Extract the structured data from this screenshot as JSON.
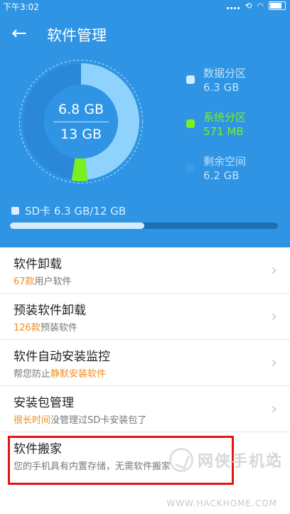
{
  "status_bar": {
    "time": "下午3:02"
  },
  "header": {
    "title": "软件管理"
  },
  "storage": {
    "used_label": "6.8 GB",
    "total_label": "13 GB",
    "segments": [
      {
        "name": "数据分区",
        "value_label": "6.3 GB",
        "value_gb": 6.3,
        "color": "#8fd2fb"
      },
      {
        "name": "系统分区",
        "value_label": "571 MB",
        "value_gb": 0.571,
        "color": "#7af020"
      },
      {
        "name": "剩余空间",
        "value_label": "6.2 GB",
        "value_gb": 6.2,
        "color": "#2b88d8"
      }
    ],
    "legend_text_colors": [
      "#bfe2ff",
      "#7af020",
      "#bfe2ff"
    ],
    "legend_dot_colors": [
      "#d4ecfd",
      "#7af020",
      "#3b9be8"
    ],
    "sd_label": "SD卡 6.3 GB/12 GB",
    "sd_fraction": 0.5
  },
  "items": [
    {
      "title": "软件卸载",
      "sub_pre": "",
      "sub_hl": "67款",
      "sub_post": "用户软件"
    },
    {
      "title": "预装软件卸载",
      "sub_pre": "",
      "sub_hl": "126款",
      "sub_post": "预装软件"
    },
    {
      "title": "软件自动安装监控",
      "sub_pre": "帮您防止",
      "sub_hl": "静默安装软件",
      "sub_post": ""
    },
    {
      "title": "安装包管理",
      "sub_pre": "",
      "sub_hl": "很长时间",
      "sub_post": "没管理过SD卡安装包了"
    },
    {
      "title": "软件搬家",
      "sub_pre": "您的手机具有内置存储，无需软件搬家",
      "sub_hl": "",
      "sub_post": ""
    }
  ],
  "watermark": {
    "text": "网侠手机站",
    "url": "WWW.HACKHOME.COM"
  },
  "colors": {
    "header_bg": "#2e94e3",
    "accent_orange": "#f08c1a",
    "highlight_box": "#e31414"
  }
}
